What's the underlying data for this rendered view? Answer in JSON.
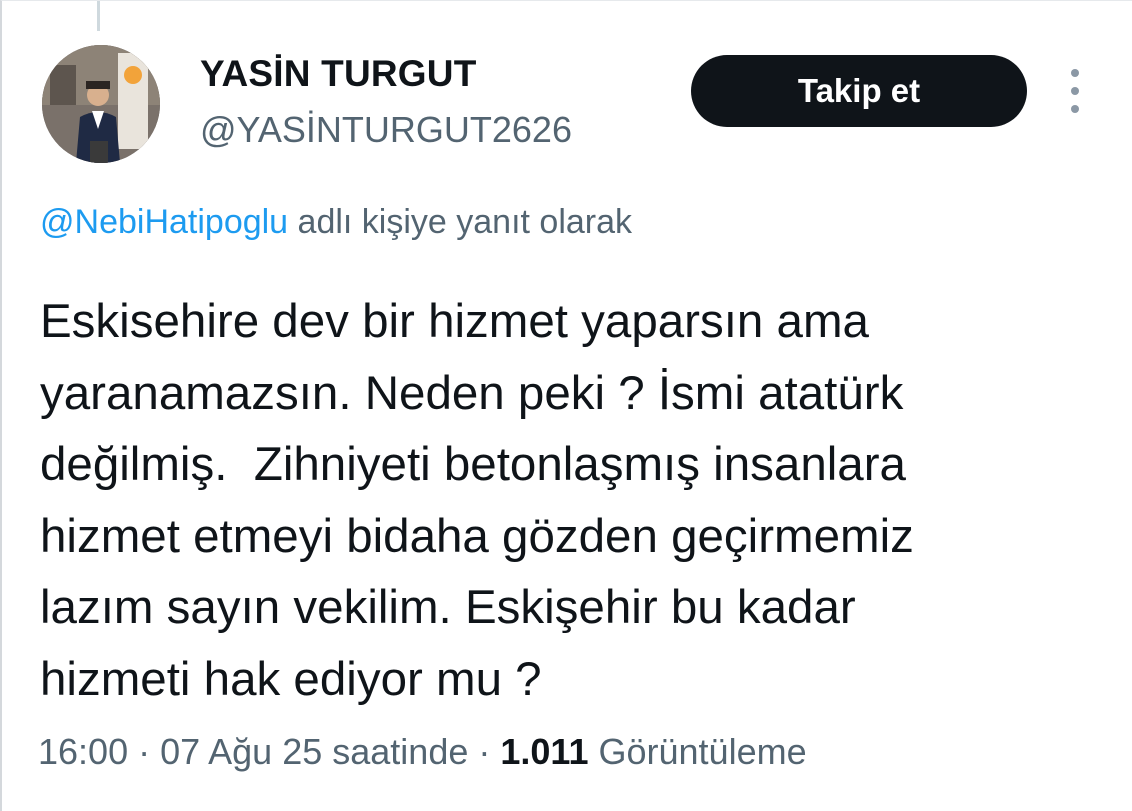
{
  "author": {
    "name": "YASİN TURGUT",
    "handle": "@YASİNTURGUT2626"
  },
  "actions": {
    "follow_label": "Takip et",
    "more_icon": "more-vertical-icon"
  },
  "reply": {
    "mention": "@NebiHatipoglu",
    "suffix": " adlı kişiye yanıt olarak"
  },
  "tweet": {
    "lines": [
      "Eskisehire dev bir hizmet yaparsın ama",
      "yaranamazsın. Neden peki ? İsmi atatürk",
      "değilmiş.  Zihniyeti betonlaşmış insanlara",
      "hizmet etmeyi bidaha gözden geçirmemiz",
      "lazım sayın vekilim. Eskişehir bu kadar",
      "hizmeti hak ediyor mu ?"
    ]
  },
  "meta": {
    "time": "16:00",
    "sep1": " · ",
    "date": "07 Ağu 25 saatinde",
    "sep2": " · ",
    "views_count": "1.011",
    "views_label": " Görüntüleme"
  },
  "colors": {
    "text_primary": "#0f1419",
    "text_secondary": "#536471",
    "link": "#1d9bf0",
    "button_bg": "#0f1419"
  }
}
